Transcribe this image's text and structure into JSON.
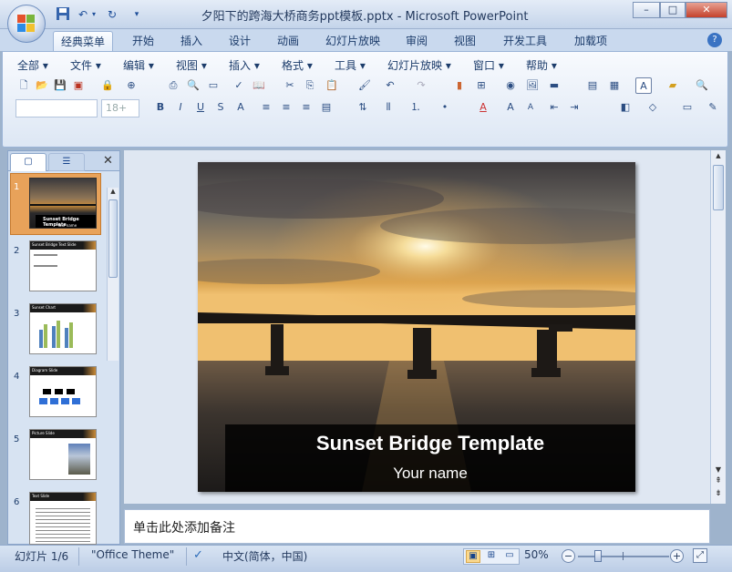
{
  "window": {
    "title": "夕阳下的跨海大桥商务ppt模板.pptx - Microsoft PowerPoint",
    "controls": [
      "–",
      "□",
      "✕"
    ]
  },
  "quick_access": {
    "items": [
      "save-icon",
      "undo-icon",
      "redo-icon",
      "customize-icon"
    ]
  },
  "ribbon_tabs": [
    "经典菜单",
    "开始",
    "插入",
    "设计",
    "动画",
    "幻灯片放映",
    "审阅",
    "视图",
    "开发工具",
    "加载项"
  ],
  "menus": [
    "全部",
    "文件",
    "编辑",
    "视图",
    "插入",
    "格式",
    "工具",
    "幻灯片放映",
    "窗口",
    "帮助"
  ],
  "font": {
    "name_value": "",
    "size_value": "18+"
  },
  "slide_panel": {
    "slides": [
      {
        "num": "1",
        "title": "Sunset Bridge Template",
        "subtitle": "Your name"
      },
      {
        "num": "2",
        "title": "Sunset Bridge Text Slide"
      },
      {
        "num": "3",
        "title": "Sunset Chart"
      },
      {
        "num": "4",
        "title": "Diagram Slide"
      },
      {
        "num": "5",
        "title": "Picture Slide"
      },
      {
        "num": "6",
        "title": "Text Slide"
      }
    ]
  },
  "slide": {
    "title": "Sunset Bridge Template",
    "subtitle": "Your name"
  },
  "notes": {
    "placeholder": "单击此处添加备注"
  },
  "status": {
    "slide_counter": "幻灯片 1/6",
    "theme": "\"Office Theme\"",
    "language": "中文(简体，中国)",
    "zoom": "50%"
  },
  "colors": {
    "accent": "#15428b",
    "selection": "#e8a25a"
  }
}
